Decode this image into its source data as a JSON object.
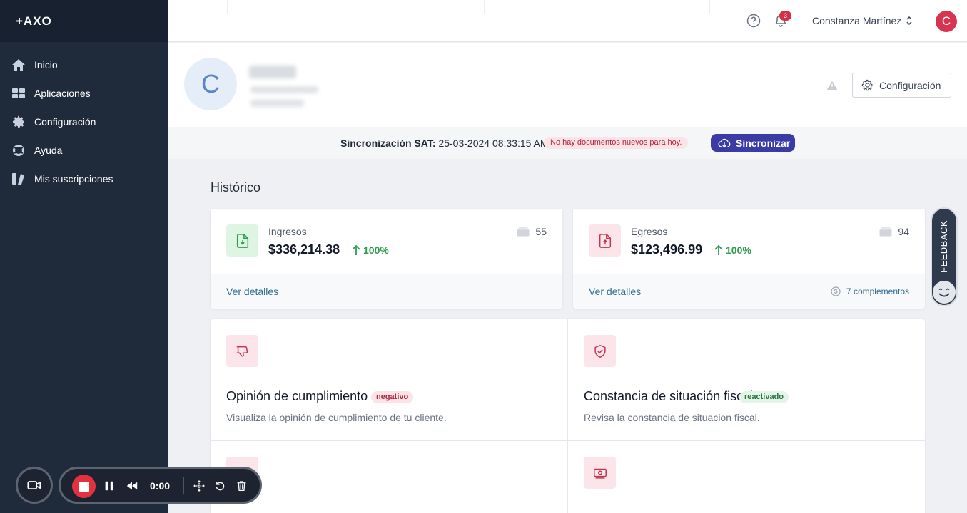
{
  "app": {
    "logo": "+AXO"
  },
  "sidebar": {
    "items": [
      {
        "label": "Inicio",
        "icon": "home-icon"
      },
      {
        "label": "Aplicaciones",
        "icon": "apps-icon"
      },
      {
        "label": "Configuración",
        "icon": "gear-icon"
      },
      {
        "label": "Ayuda",
        "icon": "lifebuoy-icon"
      },
      {
        "label": "Mis suscripciones",
        "icon": "subscriptions-icon"
      }
    ]
  },
  "topbar": {
    "notifications_count": "3",
    "user_name": "Constanza Martínez",
    "user_initial": "C"
  },
  "profile": {
    "client_initial": "C",
    "config_label": "Configuración"
  },
  "sync": {
    "label": "Sincronización SAT:",
    "datetime": "25-03-2024 08:33:15 AM",
    "status": "No hay documentos nuevos para hoy.",
    "button_label": "Sincronizar"
  },
  "historico": {
    "title": "Histórico",
    "cards": [
      {
        "label": "Ingresos",
        "amount": "$336,214.38",
        "pct": "100%",
        "count": "55",
        "link": "Ver detalles",
        "complementos": ""
      },
      {
        "label": "Egresos",
        "amount": "$123,496.99",
        "pct": "100%",
        "count": "94",
        "link": "Ver detalles",
        "complementos": "7 complementos"
      }
    ]
  },
  "tiles": [
    {
      "title": "Opinión de cumplimiento",
      "badge": "negativo",
      "desc": "Visualiza la opinión de cumplimiento de tu cliente."
    },
    {
      "title": "Constancia de situación fiscal",
      "badge": "reactivado",
      "desc": "Revisa la constancia de situacion fiscal."
    }
  ],
  "feedback": {
    "label": "FEEDBACK"
  },
  "recorder": {
    "time": "0:00"
  },
  "colors": {
    "sidebar_bg": "#1f2a3b",
    "accent": "#3b3ba6",
    "positive": "#2e9c4f",
    "negative": "#b4233e",
    "avatar": "#d9344f"
  }
}
